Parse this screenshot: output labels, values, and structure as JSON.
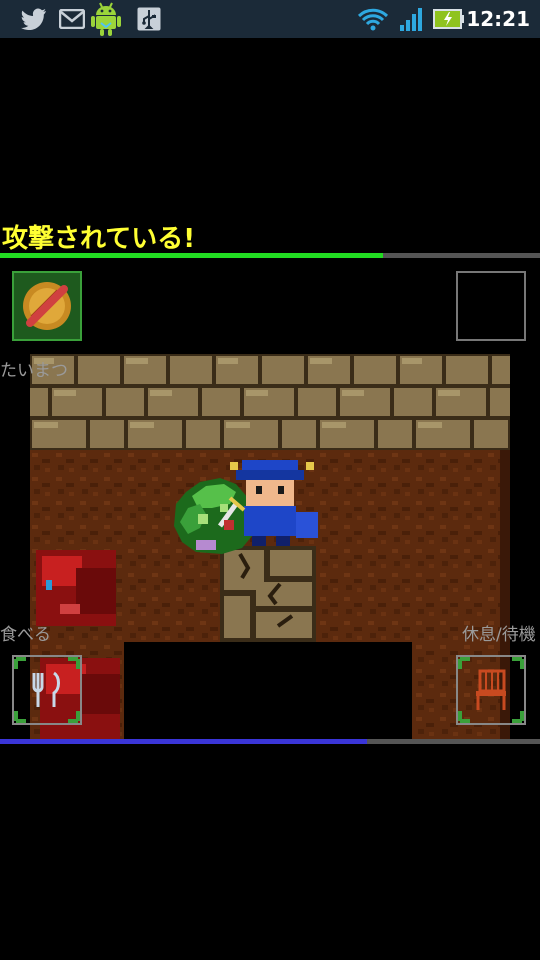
{
  "status_bar": {
    "time": "12:21",
    "left_icons": [
      "twitter-bird-icon",
      "gmail-icon",
      "android-robot-icon",
      "usb-icon"
    ],
    "right_icons": [
      "wifi-icon",
      "signal-icon",
      "battery-charging-icon"
    ]
  },
  "game": {
    "message": "攻撃されている!",
    "hp_bar": {
      "fraction": 0.71,
      "color": "#22dd22"
    },
    "mp_bar": {
      "fraction": 0.68,
      "color": "#3a35d8"
    },
    "top_left_action": {
      "label": "たいまつ",
      "icon": "torch-disabled-icon"
    },
    "top_right_slot": {
      "icon": "empty-slot"
    },
    "bottom_left_action": {
      "label": "食べる",
      "icon": "fork-knife-icon"
    },
    "bottom_right_action": {
      "label": "休息/待機",
      "icon": "chair-icon"
    },
    "colors": {
      "message": "#ffff33",
      "label": "#9a9a9a",
      "floor": "#5c2a0e",
      "wall": "#8a7650"
    }
  }
}
